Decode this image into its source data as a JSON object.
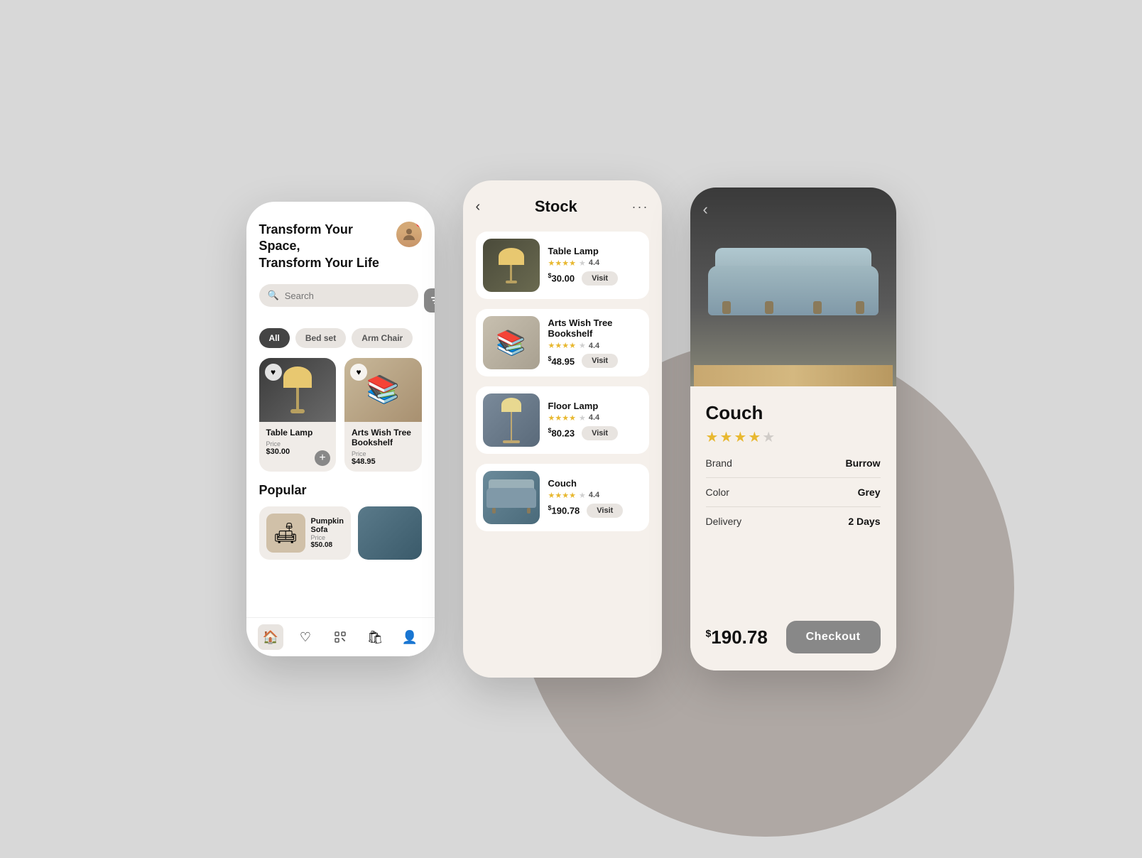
{
  "background": {
    "color": "#d8d8d8"
  },
  "phone1": {
    "header": {
      "title": "Transform Your Space,\nTransform Your Life",
      "avatar_initial": "👤"
    },
    "search": {
      "placeholder": "Search",
      "filter_icon": "⚙"
    },
    "categories": [
      {
        "label": "All",
        "active": true
      },
      {
        "label": "Bed set",
        "active": false
      },
      {
        "label": "Arm Chair",
        "active": false
      }
    ],
    "featured_products": [
      {
        "name": "Table Lamp",
        "price_label": "Price",
        "price": "$30.00",
        "favorited": true,
        "type": "lamp"
      },
      {
        "name": "Arts Wish Tree Bookshelf",
        "price_label": "Price",
        "price": "$48.95",
        "favorited": true,
        "type": "bookshelf"
      }
    ],
    "popular_section": {
      "title": "Popular",
      "items": [
        {
          "name": "Pumpkin Sofa",
          "price_label": "Price",
          "price": "$50.08",
          "type": "sofa"
        },
        {
          "name": "",
          "type": "couch"
        }
      ]
    },
    "nav": [
      {
        "icon": "🏠",
        "label": "home",
        "active": true
      },
      {
        "icon": "♡",
        "label": "favorites",
        "active": false
      },
      {
        "icon": "⊡",
        "label": "scan",
        "active": false
      },
      {
        "icon": "🛍",
        "label": "cart",
        "active": false
      },
      {
        "icon": "👤",
        "label": "profile",
        "active": false
      }
    ]
  },
  "phone2": {
    "header": {
      "back_label": "‹",
      "title": "Stock",
      "more_label": "···"
    },
    "items": [
      {
        "name": "Table Lamp",
        "rating": 4.4,
        "stars": 4,
        "price": "30.00",
        "visit_label": "Visit",
        "type": "lamp"
      },
      {
        "name": "Arts Wish Tree Bookshelf",
        "rating": 4.4,
        "stars": 4,
        "price": "48.95",
        "visit_label": "Visit",
        "type": "bookshelf"
      },
      {
        "name": "Floor Lamp",
        "rating": 4.4,
        "stars": 4,
        "price": "80.23",
        "visit_label": "Visit",
        "type": "floor_lamp"
      },
      {
        "name": "Couch",
        "rating": 4.4,
        "stars": 4,
        "price": "190.78",
        "visit_label": "Visit",
        "type": "couch"
      }
    ]
  },
  "phone3": {
    "back_label": "‹",
    "product_name": "Couch",
    "rating": 4.0,
    "stars_filled": 4,
    "specs": [
      {
        "label": "Brand",
        "value": "Burrow"
      },
      {
        "label": "Color",
        "value": "Grey"
      },
      {
        "label": "Delivery",
        "value": "2 Days"
      }
    ],
    "price": "190.78",
    "checkout_label": "Checkout"
  }
}
